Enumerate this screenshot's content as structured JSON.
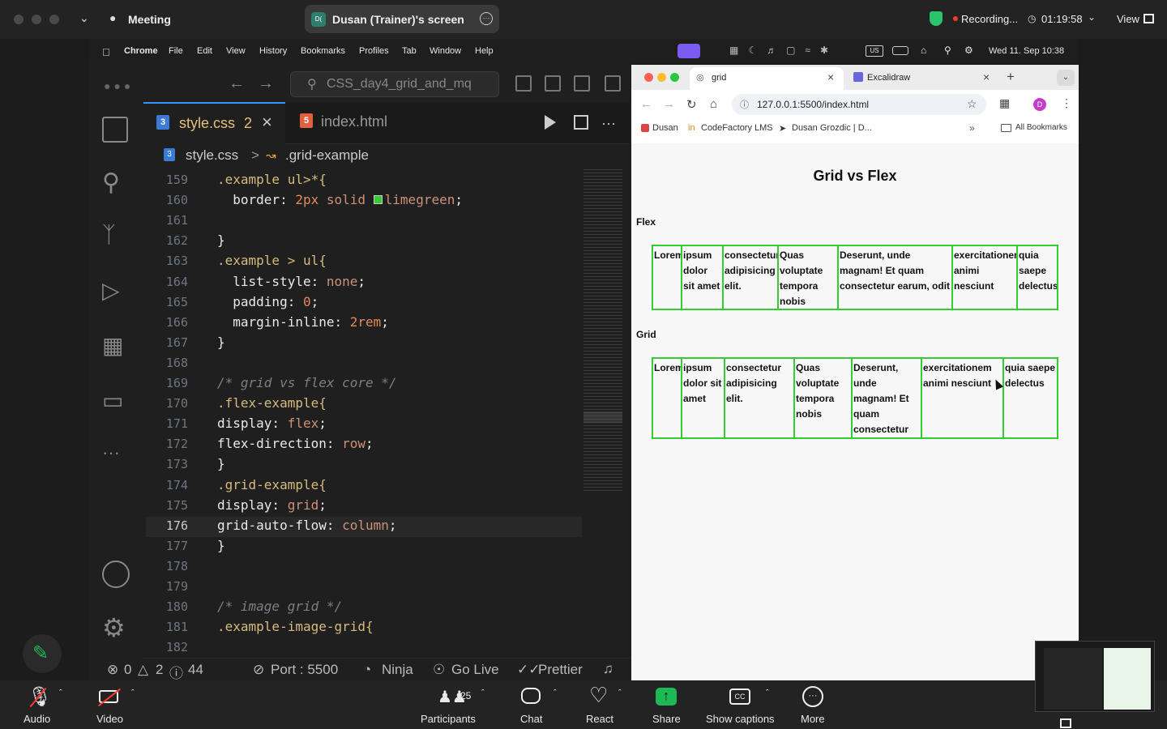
{
  "zoom_top": {
    "meeting_label": "Meeting",
    "share_label": "Dusan (Trainer)'s screen",
    "share_avatar": "D(",
    "recording_label": "Recording...",
    "timer": "01:19:58",
    "view_label": "View"
  },
  "mac_menu": {
    "app": "Chrome",
    "items": [
      "File",
      "Edit",
      "View",
      "History",
      "Bookmarks",
      "Profiles",
      "Tab",
      "Window",
      "Help"
    ],
    "datetime": "Wed 11. Sep  10:38"
  },
  "vscode": {
    "search": "CSS_day4_grid_and_mq",
    "tabs": [
      {
        "label": "style.css",
        "badge": "2"
      },
      {
        "label": "index.html"
      }
    ],
    "breadcrumb": {
      "file": "style.css",
      "symbol": ".grid-example"
    },
    "line_numbers": [
      "159",
      "160",
      "161",
      "162",
      "163",
      "164",
      "165",
      "166",
      "167",
      "168",
      "169",
      "170",
      "171",
      "172",
      "173",
      "174",
      "175",
      "176",
      "177",
      "178",
      "179",
      "180",
      "181",
      "182"
    ],
    "status": {
      "errors": "0",
      "warnings": "2",
      "info": "44",
      "port": "Port : 5500",
      "ninja": "Ninja",
      "golive": "Go Live",
      "prettier": "Prettier"
    }
  },
  "browser": {
    "tabs": [
      {
        "label": "grid"
      },
      {
        "label": "Excalidraw"
      }
    ],
    "url": "127.0.0.1:5500/index.html",
    "bookmarks": [
      "Dusan",
      "CodeFactory LMS",
      "Dusan Grozdic | D..."
    ],
    "all_bookmarks": "All Bookmarks",
    "avatar": "D"
  },
  "webpage": {
    "title": "Grid vs Flex",
    "flex_label": "Flex",
    "grid_label": "Grid",
    "flex_items": [
      "Lorem",
      "ipsum dolor sit amet",
      "consectetur adipisicing elit.",
      "Quas voluptate tempora nobis",
      "Deserunt, unde magnam! Et quam consectetur earum, odit",
      "exercitationem animi nesciunt",
      "quia saepe delectus"
    ],
    "grid_items": [
      "Lorem",
      "ipsum dolor sit amet",
      "consectetur adipisicing elit.",
      "Quas voluptate tempora nobis",
      "Deserunt, unde magnam! Et quam consectetur earum, odit",
      "exercitationem animi nesciunt",
      "quia saepe delectus"
    ]
  },
  "zoom_bottom": {
    "audio": "Audio",
    "video": "Video",
    "participants": "Participants",
    "participants_count": "25",
    "chat": "Chat",
    "react": "React",
    "share": "Share",
    "captions": "Show captions",
    "more": "More"
  },
  "colors": {
    "limegreen": "#32cd32",
    "selector": "#d7ba7d",
    "share_green": "#1db954"
  }
}
